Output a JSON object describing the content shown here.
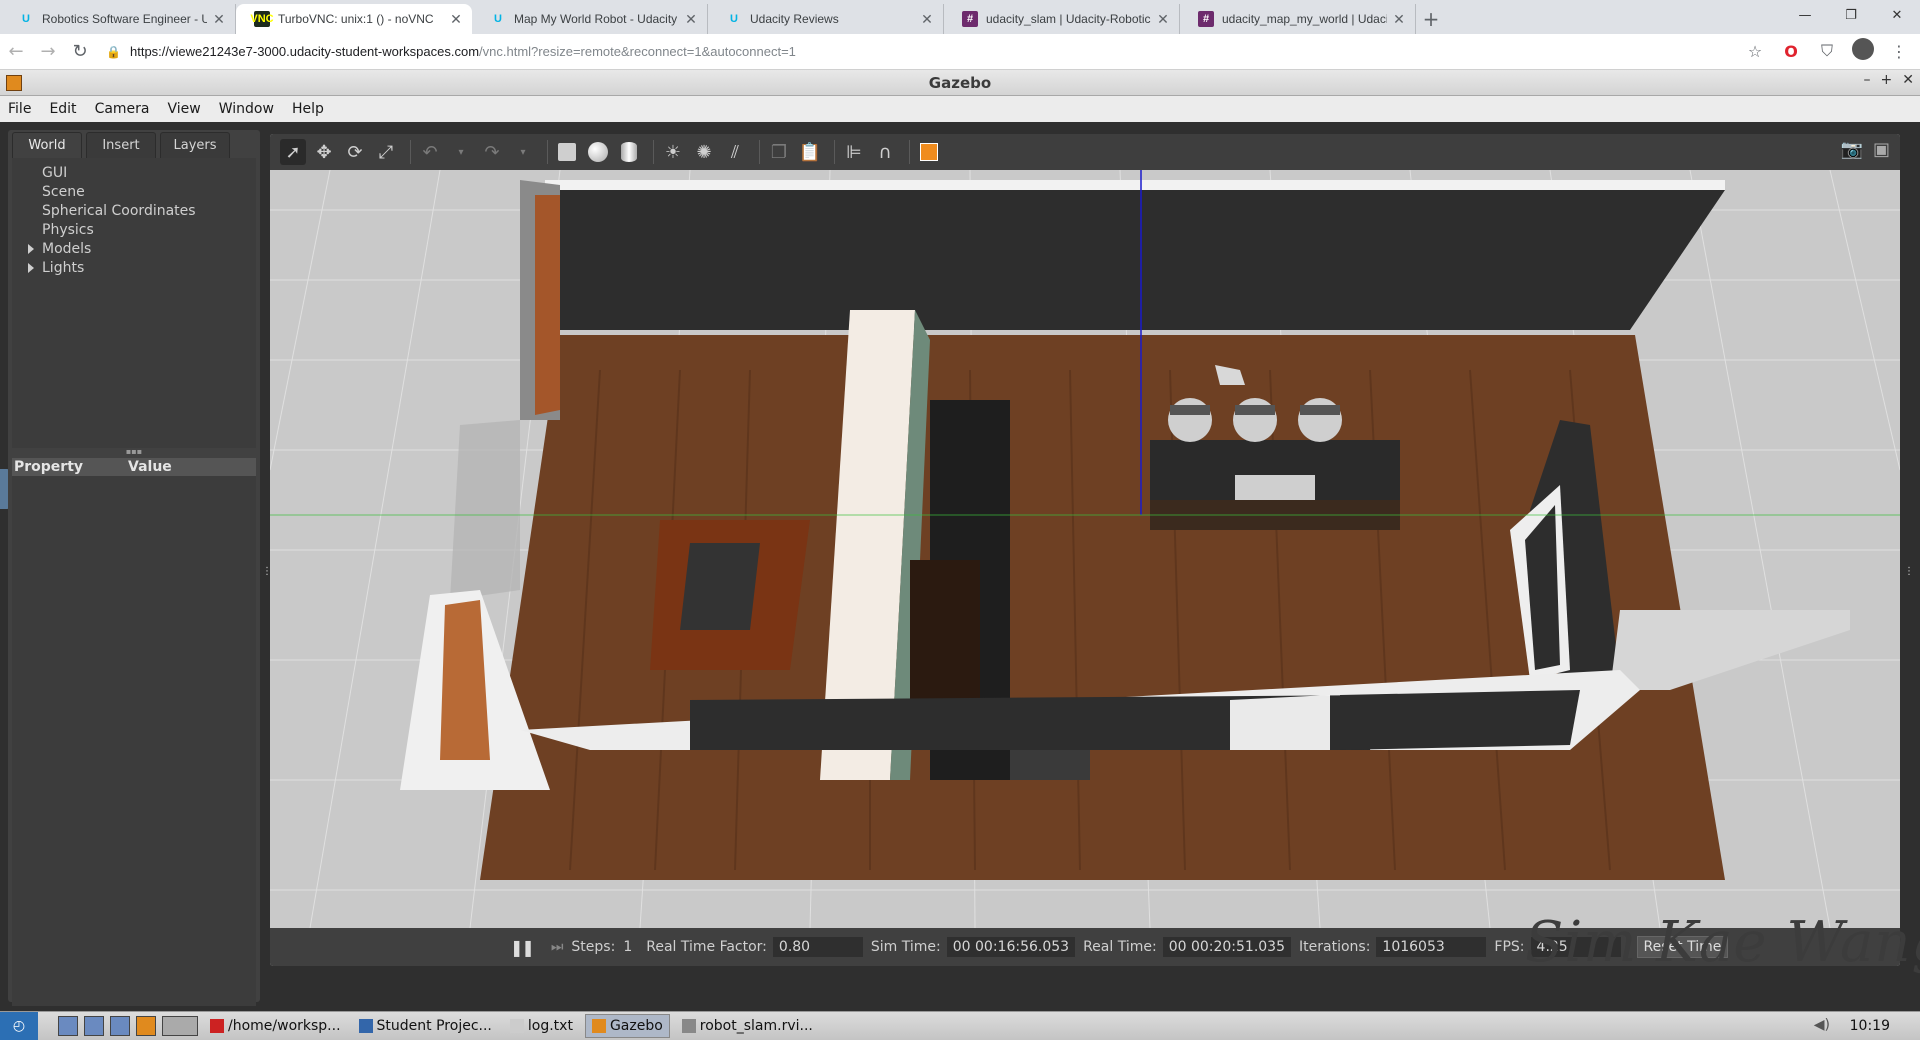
{
  "browser": {
    "tabs": [
      {
        "title": "Robotics Software Engineer - Uda",
        "icon": "udacity-icon"
      },
      {
        "title": "TurboVNC: unix:1 () - noVNC",
        "icon": "vnc-icon",
        "active": true
      },
      {
        "title": "Map My World Robot - Udacity",
        "icon": "udacity-icon"
      },
      {
        "title": "Udacity Reviews",
        "icon": "udacity-icon"
      },
      {
        "title": "udacity_slam | Udacity-Robotics-S",
        "icon": "slack-icon"
      },
      {
        "title": "udacity_map_my_world | Udacity",
        "icon": "slack-icon"
      }
    ],
    "url_host": "https://viewe21243e7-3000.udacity-student-workspaces.com",
    "url_path": "/vnc.html?resize=remote&reconnect=1&autoconnect=1"
  },
  "gazebo": {
    "window_title": "Gazebo",
    "menu": [
      "File",
      "Edit",
      "Camera",
      "View",
      "Window",
      "Help"
    ],
    "left_tabs": [
      "World",
      "Insert",
      "Layers"
    ],
    "tree": [
      {
        "label": "GUI",
        "expandable": false
      },
      {
        "label": "Scene",
        "expandable": false
      },
      {
        "label": "Spherical Coordinates",
        "expandable": false
      },
      {
        "label": "Physics",
        "expandable": false
      },
      {
        "label": "Models",
        "expandable": true
      },
      {
        "label": "Lights",
        "expandable": true
      }
    ],
    "prop_header": {
      "property": "Property",
      "value": "Value"
    },
    "bottom": {
      "steps_label": "Steps:",
      "steps_value": "1",
      "rtf_label": "Real Time Factor:",
      "rtf_value": "0.80",
      "sim_label": "Sim Time:",
      "sim_value": "00 00:16:56.053",
      "real_label": "Real Time:",
      "real_value": "00 00:20:51.035",
      "iter_label": "Iterations:",
      "iter_value": "1016053",
      "fps_label": "FPS:",
      "fps_value": "4.25",
      "reset_label": "Reset Time"
    },
    "watermark": "Sim Kae Wang"
  },
  "taskbar": {
    "tasks": [
      "/home/worksp...",
      "Student Projec...",
      "log.txt",
      "Gazebo",
      "robot_slam.rvi..."
    ],
    "clock": "10:19"
  },
  "colors": {
    "floor": "#6e4023",
    "wall_dark": "#2d2d2d",
    "grid_bg": "#c9c9c9",
    "accent_orange": "#f08c1e"
  }
}
